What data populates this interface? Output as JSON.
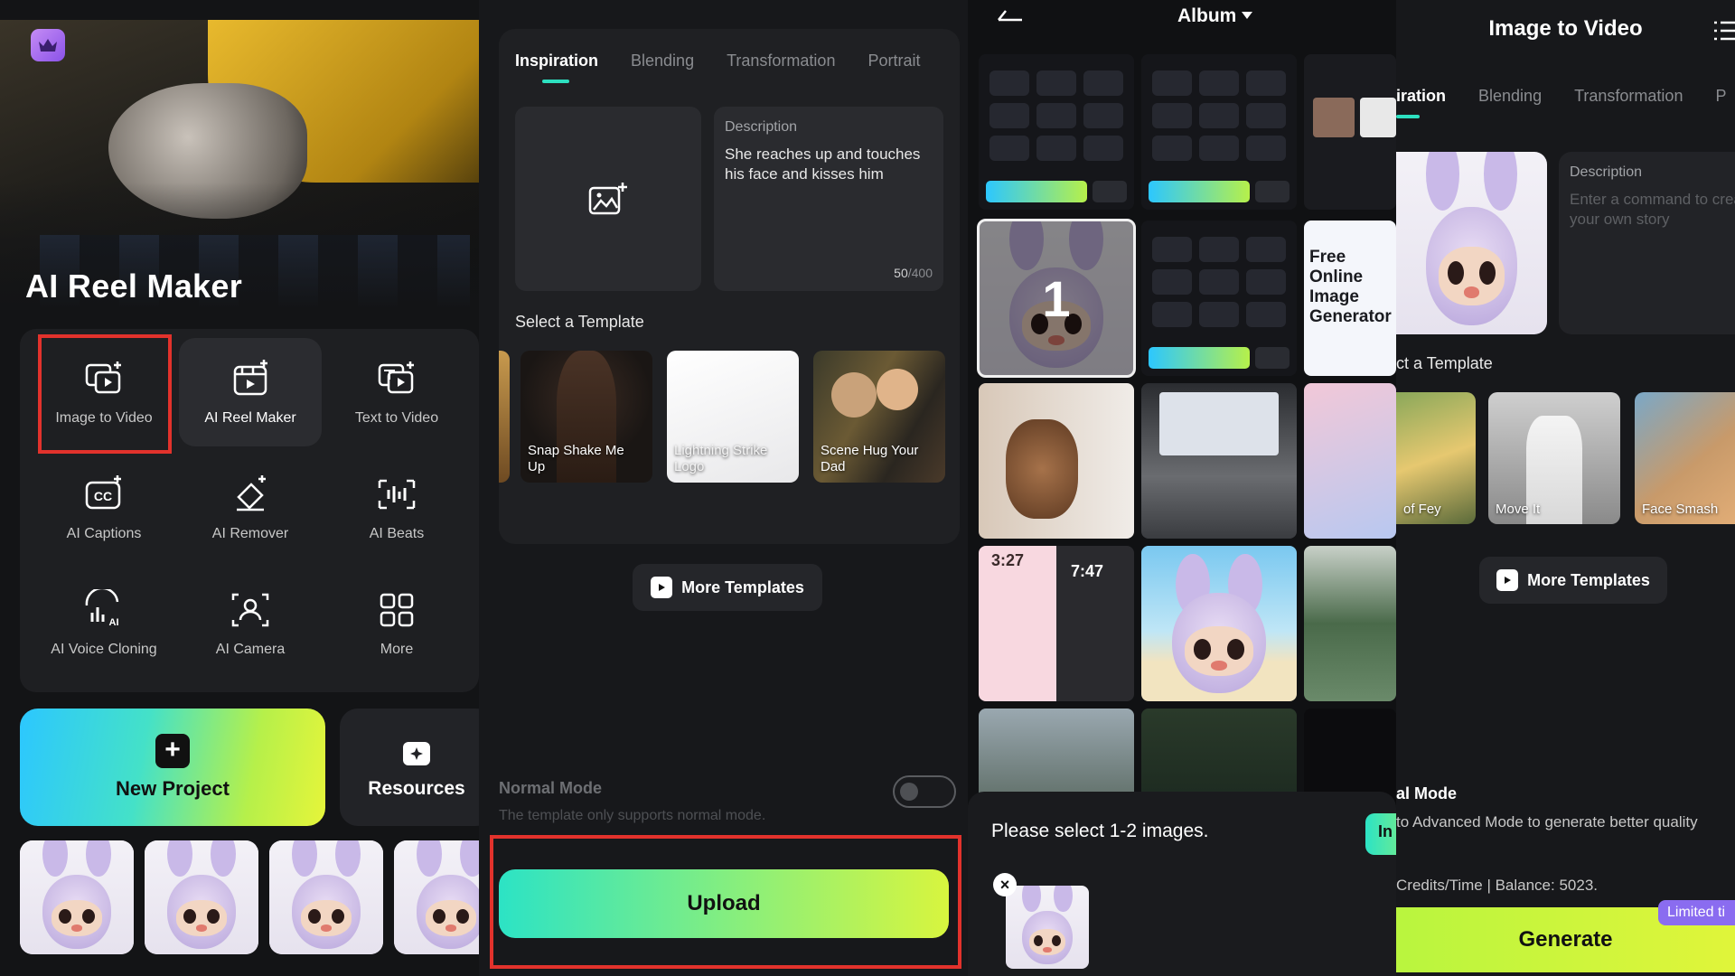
{
  "panel1": {
    "hero_title": "AI Reel Maker",
    "tools": [
      {
        "label": "Image to Video",
        "icon": "image-to-video-icon",
        "highlighted": true
      },
      {
        "label": "AI Reel Maker",
        "icon": "reel-maker-icon",
        "selected": true
      },
      {
        "label": "Text to Video",
        "icon": "text-to-video-icon"
      },
      {
        "label": "AI Captions",
        "icon": "captions-icon"
      },
      {
        "label": "AI Remover",
        "icon": "eraser-icon"
      },
      {
        "label": "AI Beats",
        "icon": "beats-icon"
      },
      {
        "label": "AI Voice Cloning",
        "icon": "voice-cloning-icon"
      },
      {
        "label": "AI Camera",
        "icon": "camera-icon"
      },
      {
        "label": "More",
        "icon": "grid-icon"
      }
    ],
    "new_project": "New Project",
    "resources": "Resources"
  },
  "panel2": {
    "tabs": [
      "Inspiration",
      "Blending",
      "Transformation",
      "Portrait"
    ],
    "description_title": "Description",
    "description_text": "She reaches up and touches his face and kisses him",
    "char_count": "50",
    "char_max": "/400",
    "select_template": "Select a Template",
    "templates": [
      {
        "label": "Snap Shake Me Up"
      },
      {
        "label": "Lightning Strike Logo"
      },
      {
        "label": "Scene Hug Your Dad"
      }
    ],
    "more_templates": "More Templates",
    "mode_title": "Normal Mode",
    "mode_sub": "The template only supports normal mode.",
    "upload": "Upload"
  },
  "panel3": {
    "title": "Album",
    "selected_index": "1",
    "time_a": "3:27",
    "time_b": "7:47",
    "ad_text": "Free Online Image Generator",
    "hint": "Please select 1-2 images.",
    "go_label": "In"
  },
  "panel4": {
    "title": "Image to Video",
    "tabs": [
      "iration",
      "Blending",
      "Transformation",
      "P"
    ],
    "description_title": "Description",
    "description_placeholder": "Enter a command to create your own story",
    "select_template": "ct a Template",
    "templates": [
      {
        "label": "of Fey"
      },
      {
        "label": "Move It"
      },
      {
        "label": "Face Smash"
      }
    ],
    "more_templates": "More Templates",
    "mode_title": "al Mode",
    "mode_sub": "to Advanced Mode to generate better quality",
    "credits": "Credits/Time | Balance: 5023.",
    "generate": "Generate",
    "badge": "Limited ti"
  },
  "colors": {
    "accent_teal": "#2de0c0",
    "accent_lime": "#d8f53e",
    "highlight_red": "#e2322c",
    "badge_purple": "#8a6cf0"
  }
}
